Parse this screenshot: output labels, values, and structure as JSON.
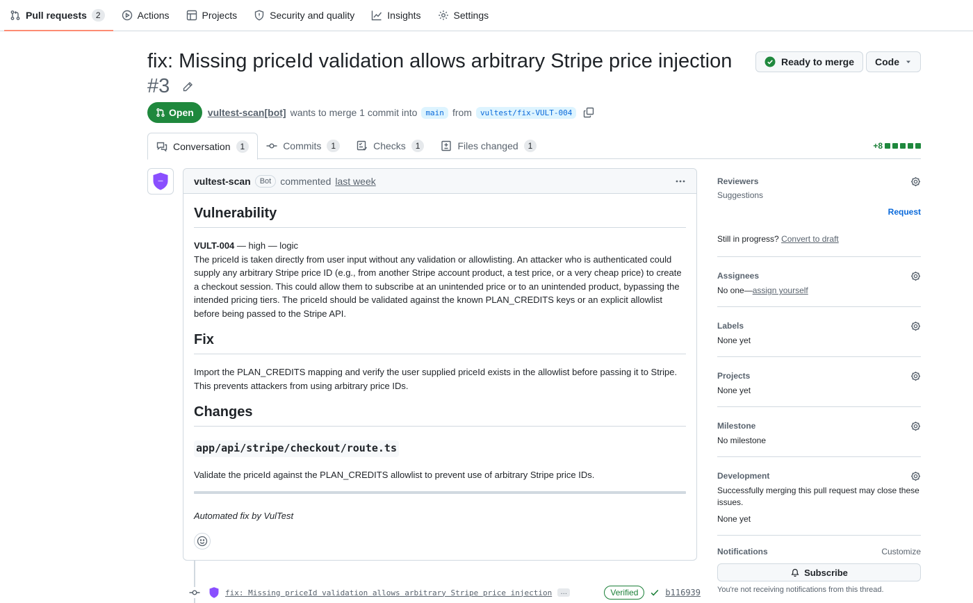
{
  "nav": {
    "items": [
      {
        "label": "Pull requests",
        "counter": "2"
      },
      {
        "label": "Actions"
      },
      {
        "label": "Projects"
      },
      {
        "label": "Security and quality"
      },
      {
        "label": "Insights"
      },
      {
        "label": "Settings"
      }
    ]
  },
  "pr": {
    "title": "fix: Missing priceId validation allows arbitrary Stripe price injection",
    "number": "#3",
    "state": "Open",
    "author": "vultest-scan[bot]",
    "meta_text": "wants to merge 1 commit into",
    "base_branch": "main",
    "from_text": "from",
    "head_branch": "vultest/fix-VULT-004"
  },
  "actions": {
    "merge_status": "Ready to merge",
    "code_label": "Code"
  },
  "tabs": [
    {
      "label": "Conversation",
      "counter": "1"
    },
    {
      "label": "Commits",
      "counter": "1"
    },
    {
      "label": "Checks",
      "counter": "1"
    },
    {
      "label": "Files changed",
      "counter": "1"
    }
  ],
  "diffstat": {
    "text": "+8",
    "blocks": 5
  },
  "comment": {
    "author": "vultest-scan",
    "badge": "Bot",
    "action": "commented",
    "time": "last week",
    "h_vuln": "Vulnerability",
    "vuln_id": "VULT-004",
    "vuln_meta": " — high — logic",
    "vuln_desc": "The priceId is taken directly from user input without any validation or allowlisting. An attacker who is authenticated could supply any arbitrary Stripe price ID (e.g., from another Stripe account product, a test price, or a very cheap price) to create a checkout session. This could allow them to subscribe at an unintended price or to an unintended product, bypassing the intended pricing tiers. The priceId should be validated against the known PLAN_CREDITS keys or an explicit allowlist before being passed to the Stripe API.",
    "h_fix": "Fix",
    "fix_desc": "Import the PLAN_CREDITS mapping and verify the user supplied priceId exists in the allowlist before passing it to Stripe. This prevents attackers from using arbitrary price IDs.",
    "h_changes": "Changes",
    "file_path": "app/api/stripe/checkout/route.ts",
    "change_desc": "Validate the priceId against the PLAN_CREDITS allowlist to prevent use of arbitrary Stripe price IDs.",
    "footer": "Automated fix by VulTest"
  },
  "commit": {
    "message": "fix: Missing priceId validation allows arbitrary Stripe price injection",
    "more": "…",
    "verified": "Verified",
    "sha": "b116939"
  },
  "sidebar": {
    "reviewers": {
      "title": "Reviewers",
      "suggestions": "Suggestions",
      "request": "Request"
    },
    "draft": {
      "prefix": "Still in progress?",
      "link": "Convert to draft"
    },
    "assignees": {
      "title": "Assignees",
      "none": "No one—",
      "link": "assign yourself"
    },
    "labels": {
      "title": "Labels",
      "value": "None yet"
    },
    "projects": {
      "title": "Projects",
      "value": "None yet"
    },
    "milestone": {
      "title": "Milestone",
      "value": "No milestone"
    },
    "development": {
      "title": "Development",
      "desc": "Successfully merging this pull request may close these issues.",
      "value": "None yet"
    },
    "notifications": {
      "title": "Notifications",
      "customize": "Customize",
      "subscribe": "Subscribe",
      "note": "You're not receiving notifications from this thread."
    }
  },
  "colors": {
    "accent_green": "#1f883d",
    "link_blue": "#0969da",
    "active_underline": "#fd8c73",
    "bot_purple": "#8a4fff"
  }
}
